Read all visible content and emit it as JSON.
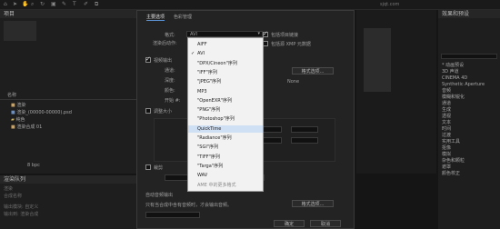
{
  "top_bar": {
    "center_text": "sjqt.com"
  },
  "left_panel": {
    "header": "项目",
    "column_name": "名称",
    "items": [
      {
        "label": "渲染"
      },
      {
        "label": "渲染_(00000-00000).psd"
      },
      {
        "label": "纯色"
      },
      {
        "label": "渲染合成 01"
      }
    ],
    "footer": "8 bpc"
  },
  "render_queue": {
    "header": "渲染队列",
    "rows": [
      "渲染",
      "合成名称",
      "输出模块: 自定义",
      "输出到: 渲染合成"
    ]
  },
  "dialog": {
    "tabs": [
      "主要选项",
      "色彩管理"
    ],
    "format_label": "格式:",
    "format_value": "AVI",
    "post_render_label": "渲染后动作:",
    "include_project_link": "包括项目链接",
    "include_xmp": "包括源 XMP 元数据",
    "video_output": "视频输出",
    "channels_label": "通道:",
    "depth_label": "深度:",
    "color_label": "颜色:",
    "start_label": "开始 #:",
    "format_options_btn": "格式选项...",
    "none_text": "None",
    "resize_label": "调整大小",
    "crop_label": "裁剪",
    "audio_label": "自动音频输出",
    "audio_note": "只有当合成中含有音频时，才会输出音频。",
    "audio_options_btn": "格式选项...",
    "ok_btn": "确定",
    "cancel_btn": "取消",
    "dropdown_options": [
      {
        "label": "AIFF",
        "checked": false,
        "selected": false,
        "disabled": false
      },
      {
        "label": "AVI",
        "checked": true,
        "selected": false,
        "disabled": false
      },
      {
        "label": "\"DPX/Cineon\"序列",
        "checked": false,
        "selected": false,
        "disabled": false
      },
      {
        "label": "\"IFF\"序列",
        "checked": false,
        "selected": false,
        "disabled": false
      },
      {
        "label": "\"JPEG\"序列",
        "checked": false,
        "selected": false,
        "disabled": false
      },
      {
        "label": "MP3",
        "checked": false,
        "selected": false,
        "disabled": false
      },
      {
        "label": "\"OpenEXR\"序列",
        "checked": false,
        "selected": false,
        "disabled": false
      },
      {
        "label": "\"PNG\"序列",
        "checked": false,
        "selected": false,
        "disabled": false
      },
      {
        "label": "\"Photoshop\"序列",
        "checked": false,
        "selected": false,
        "disabled": false
      },
      {
        "label": "QuickTime",
        "checked": false,
        "selected": true,
        "disabled": false
      },
      {
        "label": "\"Radiance\"序列",
        "checked": false,
        "selected": false,
        "disabled": false
      },
      {
        "label": "\"SGI\"序列",
        "checked": false,
        "selected": false,
        "disabled": false
      },
      {
        "label": "\"TIFF\"序列",
        "checked": false,
        "selected": false,
        "disabled": false
      },
      {
        "label": "\"Targa\"序列",
        "checked": false,
        "selected": false,
        "disabled": false
      },
      {
        "label": "WAV",
        "checked": false,
        "selected": false,
        "disabled": false
      },
      {
        "label": "AME 中的更多格式",
        "checked": false,
        "selected": false,
        "disabled": true
      }
    ]
  },
  "right_panel": {
    "header": "效果和预设",
    "items": [
      "* 动画预设",
      "3D 声道",
      "CINEMA 4D",
      "Synthetic Aperture",
      "音频",
      "模糊和锐化",
      "通道",
      "生成",
      "透视",
      "文本",
      "时间",
      "过渡",
      "实用工具",
      "抠像",
      "模拟",
      "杂色和颗粒",
      "遮罩",
      "颜色校正"
    ]
  }
}
